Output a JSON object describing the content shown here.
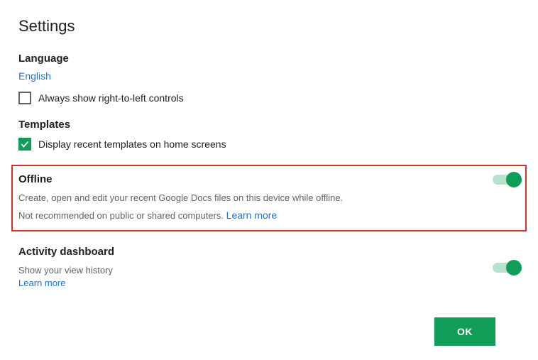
{
  "page_title": "Settings",
  "language": {
    "title": "Language",
    "value": "English",
    "rtl_label": "Always show right-to-left controls",
    "rtl_checked": false
  },
  "templates": {
    "title": "Templates",
    "label": "Display recent templates on home screens",
    "checked": true
  },
  "offline": {
    "title": "Offline",
    "desc1": "Create, open and edit your recent Google Docs files on this device while offline.",
    "desc2_prefix": "Not recommended on public or shared computers. ",
    "learn_more": "Learn more",
    "enabled": true
  },
  "activity": {
    "title": "Activity dashboard",
    "desc": "Show your view history",
    "learn_more": "Learn more",
    "enabled": true
  },
  "ok_label": "OK"
}
